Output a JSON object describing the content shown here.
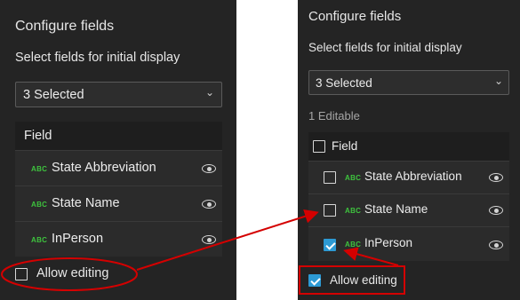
{
  "left": {
    "title": "Configure fields",
    "subtitle": "Select fields for initial display",
    "select_value": "3 Selected",
    "table_header": "Field",
    "rows": [
      {
        "type": "ABC",
        "label": "State Abbreviation"
      },
      {
        "type": "ABC",
        "label": "State Name"
      },
      {
        "type": "ABC",
        "label": "InPerson"
      }
    ],
    "allow_editing_label": "Allow editing",
    "allow_editing_checked": false
  },
  "right": {
    "title": "Configure fields",
    "subtitle": "Select fields for initial display",
    "select_value": "3 Selected",
    "editable_count": "1 Editable",
    "table_header": "Field",
    "rows": [
      {
        "type": "ABC",
        "label": "State Abbreviation",
        "checked": false
      },
      {
        "type": "ABC",
        "label": "State Name",
        "checked": false
      },
      {
        "type": "ABC",
        "label": "InPerson",
        "checked": true
      }
    ],
    "allow_editing_label": "Allow editing",
    "allow_editing_checked": true
  },
  "colors": {
    "panel_bg": "#242424",
    "accent_blue": "#2d9ad4",
    "field_type_green": "#3ec33e",
    "annotation_red": "#d40000"
  },
  "icons": {
    "eye": "eye-icon",
    "dropdown": "chevron-down-icon",
    "checkbox": "checkbox-icon"
  }
}
